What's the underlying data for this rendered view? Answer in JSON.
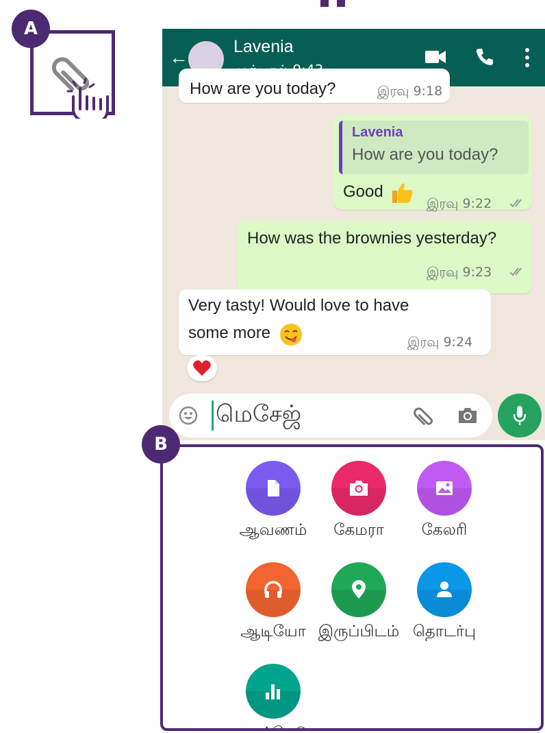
{
  "callouts": {
    "a": "A",
    "b": "B"
  },
  "header": {
    "contact_name": "Lavenia",
    "status": "முற்பகல் 9:43"
  },
  "messages": {
    "m0": {
      "text": "How are you today?",
      "time": "இரவு 9:18"
    },
    "m1": {
      "quote_name": "Lavenia",
      "quote_text": "How are you today?",
      "text": "Good",
      "time": "இரவு 9:22"
    },
    "m2": {
      "text": "How was the brownies yesterday?",
      "time": "இரவு 9:23"
    },
    "m3": {
      "text_line1": "Very tasty! Would love to have",
      "text_line2": "some more",
      "time": "இரவு 9:24"
    }
  },
  "composer": {
    "placeholder": "மெசேஜ்"
  },
  "attach_options": [
    {
      "label": "ஆவணம்",
      "icon": "document-icon",
      "color": "#7a5bf0"
    },
    {
      "label": "கேமரா",
      "icon": "camera-icon",
      "color": "#ea2a6a"
    },
    {
      "label": "கேலரி",
      "icon": "gallery-icon",
      "color": "#bf5af2"
    },
    {
      "label": "ஆடியோ",
      "icon": "headphones-icon",
      "color": "#f26430"
    },
    {
      "label": "இருப்பிடம்",
      "icon": "location-pin-icon",
      "color": "#1fa855"
    },
    {
      "label": "தொடர்பு",
      "icon": "contact-icon",
      "color": "#0a97e8"
    },
    {
      "label": "வாக்கெடு",
      "icon": "poll-icon",
      "color": "#00a38c"
    }
  ],
  "colors": {
    "header": "#075e54",
    "outgoing": "#dcf8c6",
    "callout": "#4b2a73",
    "mic": "#25a35e"
  }
}
